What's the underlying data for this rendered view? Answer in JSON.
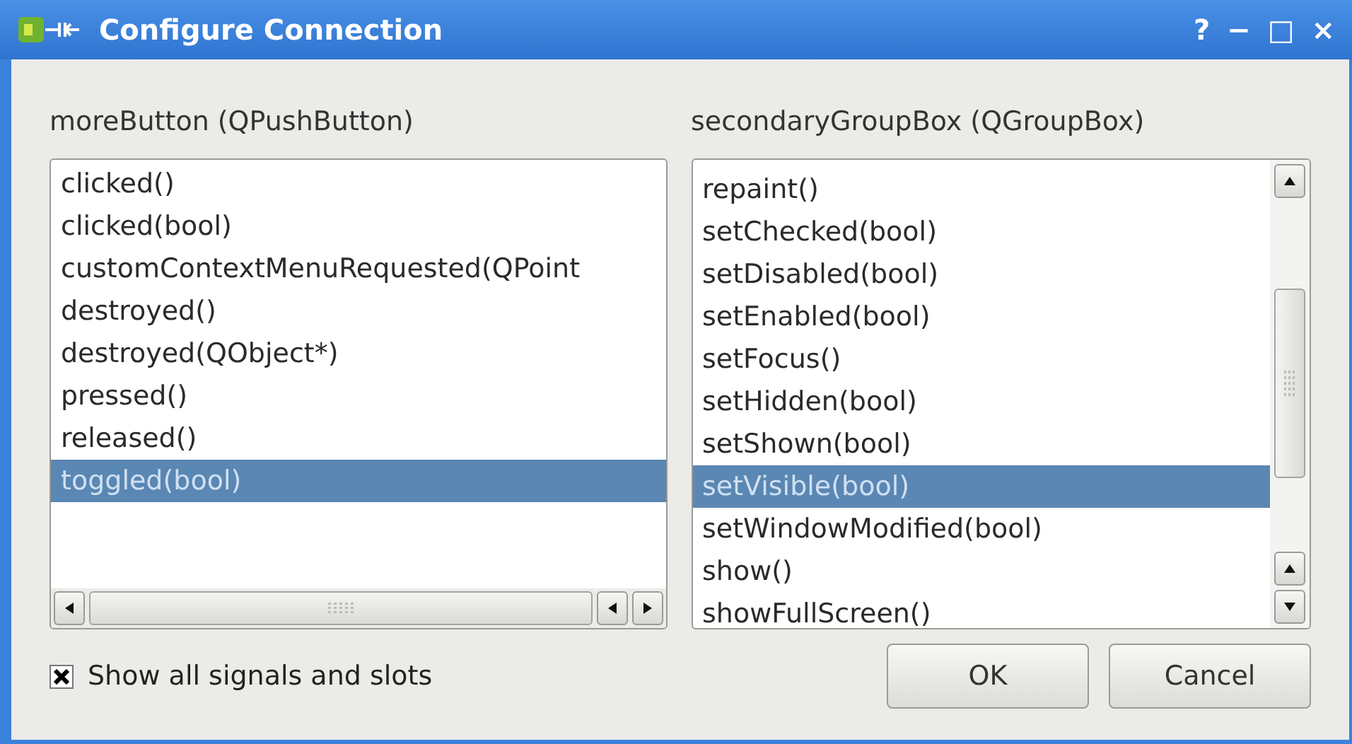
{
  "window": {
    "title": "Configure Connection"
  },
  "title_buttons": [
    "?",
    "−",
    "□",
    "×"
  ],
  "signals": {
    "label": "moreButton (QPushButton)",
    "items": [
      {
        "text": "clicked()",
        "selected": false
      },
      {
        "text": "clicked(bool)",
        "selected": false
      },
      {
        "text": "customContextMenuRequested(QPoint",
        "selected": false
      },
      {
        "text": "destroyed()",
        "selected": false
      },
      {
        "text": "destroyed(QObject*)",
        "selected": false
      },
      {
        "text": "pressed()",
        "selected": false
      },
      {
        "text": "released()",
        "selected": false
      },
      {
        "text": "toggled(bool)",
        "selected": true
      }
    ]
  },
  "slots": {
    "label": "secondaryGroupBox (QGroupBox)",
    "items": [
      {
        "text": "repaint()",
        "selected": false
      },
      {
        "text": "setChecked(bool)",
        "selected": false
      },
      {
        "text": "setDisabled(bool)",
        "selected": false
      },
      {
        "text": "setEnabled(bool)",
        "selected": false
      },
      {
        "text": "setFocus()",
        "selected": false
      },
      {
        "text": "setHidden(bool)",
        "selected": false
      },
      {
        "text": "setShown(bool)",
        "selected": false
      },
      {
        "text": "setVisible(bool)",
        "selected": true
      },
      {
        "text": "setWindowModified(bool)",
        "selected": false
      },
      {
        "text": "show()",
        "selected": false
      },
      {
        "text": "showFullScreen()",
        "selected": false
      }
    ]
  },
  "show_all": {
    "label": "Show all signals and slots",
    "checked": true
  },
  "buttons": [
    "OK",
    "Cancel"
  ]
}
